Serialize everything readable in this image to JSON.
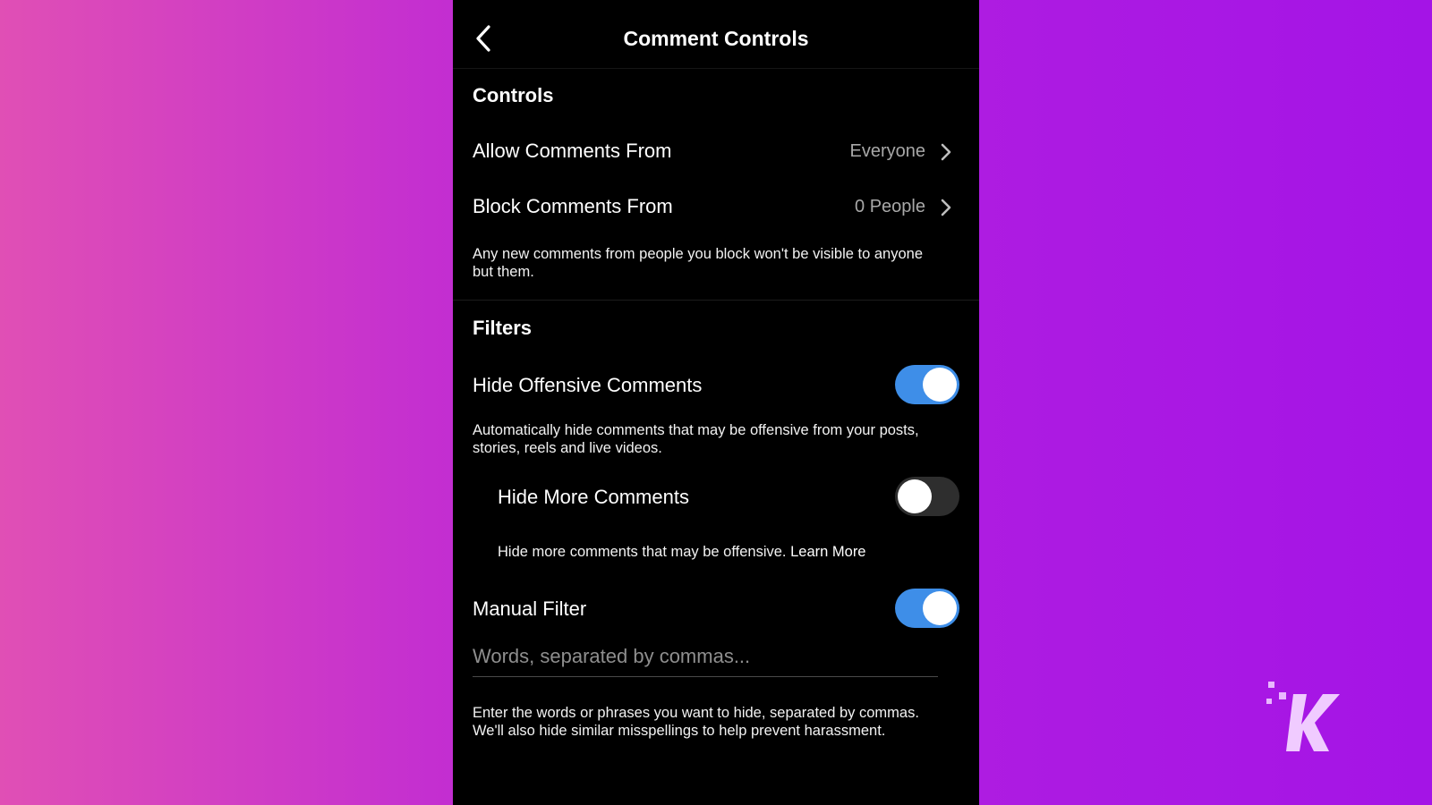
{
  "header": {
    "title": "Comment Controls"
  },
  "controls": {
    "section_title": "Controls",
    "allow_comments": {
      "label": "Allow Comments From",
      "value": "Everyone"
    },
    "block_comments": {
      "label": "Block Comments From",
      "value": "0 People"
    },
    "block_note": "Any new comments from people you block won't be visible to anyone but them."
  },
  "filters": {
    "section_title": "Filters",
    "hide_offensive": {
      "label": "Hide Offensive Comments",
      "enabled": true,
      "note": "Automatically hide comments that may be offensive from your posts, stories, reels and live videos."
    },
    "hide_more": {
      "label": "Hide More Comments",
      "enabled": false,
      "note": "Hide more comments that may be offensive.",
      "learn_more": "Learn More"
    },
    "manual_filter": {
      "label": "Manual Filter",
      "enabled": true,
      "placeholder": "Words, separated by commas...",
      "value": "",
      "note": "Enter the words or phrases you want to hide, separated by commas. We'll also hide similar misspellings to help prevent harassment."
    }
  },
  "colors": {
    "toggle_on": "#3e8ee8",
    "toggle_off": "#2e2e2e",
    "background_left": "#e04fb5",
    "background_right": "#a414e6"
  },
  "icons": {
    "back": "chevron-left-icon",
    "row_chevron": "chevron-right-icon",
    "watermark": "knowtechie-k-logo"
  }
}
